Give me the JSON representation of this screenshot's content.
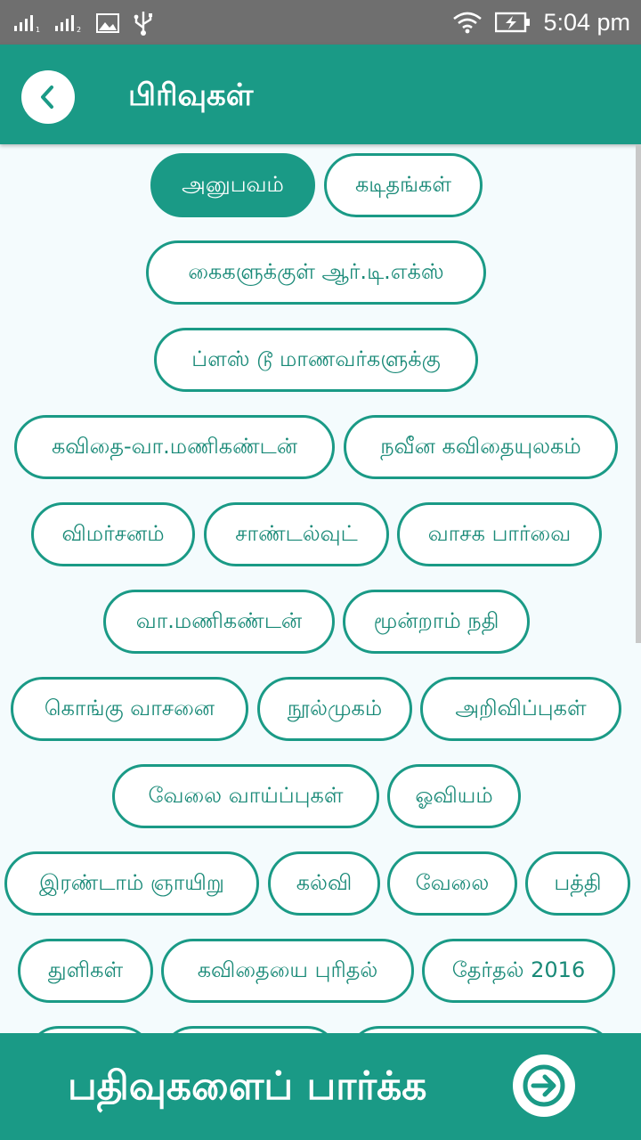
{
  "status_bar": {
    "time": "5:04 pm",
    "icons": [
      "signal-1-icon",
      "signal-2-icon",
      "image-icon",
      "usb-icon",
      "wifi-icon",
      "battery-charging-icon"
    ]
  },
  "app_bar": {
    "title": "பிரிவுகள்",
    "back_icon": "chevron-left-icon"
  },
  "categories": [
    {
      "label": "அனுபவம்",
      "selected": true
    },
    {
      "label": "கடிதங்கள்",
      "selected": false
    },
    {
      "label": "கைகளுக்குள் ஆர்.டி.எக்ஸ்",
      "selected": false
    },
    {
      "label": "ப்ளஸ் டூ மாணவர்களுக்கு",
      "selected": false
    },
    {
      "label": "கவிதை-வா.மணிகண்டன்",
      "selected": false
    },
    {
      "label": "நவீன கவிதையுலகம்",
      "selected": false
    },
    {
      "label": "விமர்சனம்",
      "selected": false
    },
    {
      "label": "சாண்டல்வுட்",
      "selected": false
    },
    {
      "label": "வாசக பார்வை",
      "selected": false
    },
    {
      "label": "வா.மணிகண்டன்",
      "selected": false
    },
    {
      "label": "மூன்றாம் நதி",
      "selected": false
    },
    {
      "label": "கொங்கு வாசனை",
      "selected": false
    },
    {
      "label": "நூல்முகம்",
      "selected": false
    },
    {
      "label": "அறிவிப்புகள்",
      "selected": false
    },
    {
      "label": "வேலை வாய்ப்புகள்",
      "selected": false
    },
    {
      "label": "ஓவியம்",
      "selected": false
    },
    {
      "label": "இரண்டாம் ஞாயிறு",
      "selected": false
    },
    {
      "label": "கல்வி",
      "selected": false
    },
    {
      "label": "வேலை",
      "selected": false
    },
    {
      "label": "பத்தி",
      "selected": false
    },
    {
      "label": "துளிகள்",
      "selected": false
    },
    {
      "label": "கவிதையை புரிதல்",
      "selected": false
    },
    {
      "label": "தேர்தல் 2016",
      "selected": false
    }
  ],
  "bottom_bar": {
    "label": "பதிவுகளைப் பார்க்க",
    "icon": "arrow-right-circle-icon"
  },
  "colors": {
    "accent": "#1a9a86",
    "status_bar": "#6f6f6f",
    "background": "#f4fbfd"
  }
}
